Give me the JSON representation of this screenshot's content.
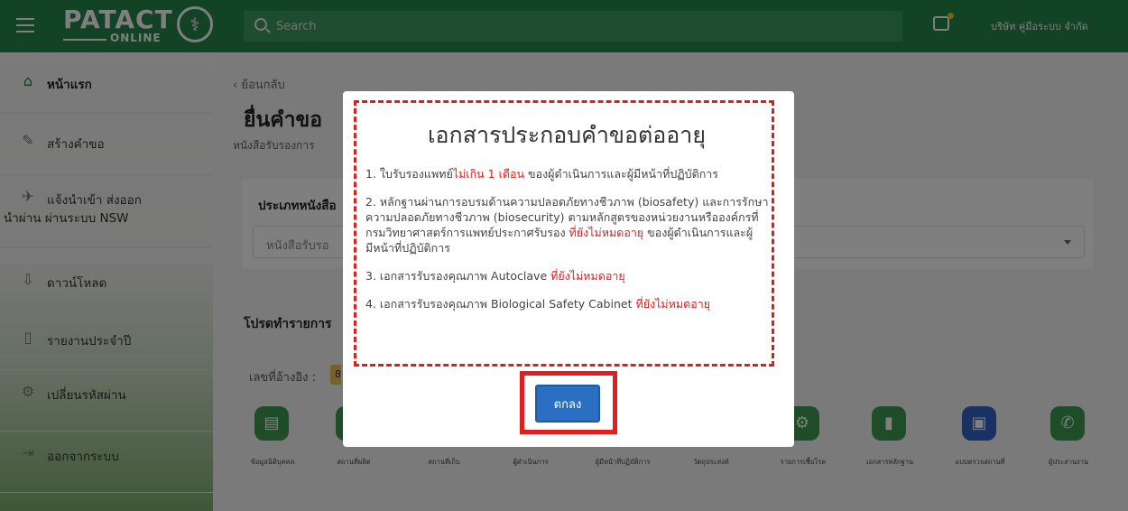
{
  "topbar": {
    "logo_main": "PATACT",
    "logo_sub": "ONLINE",
    "search_placeholder": "Search",
    "company": "บริษัท คู่มือระบบ จำกัด",
    "colors": {
      "primary": "#27864a",
      "notif_dot": "#f5c518"
    }
  },
  "sidebar": {
    "items": [
      {
        "label": "หน้าแรก",
        "icon": "home-icon"
      },
      {
        "label": "สร้างคำขอ",
        "icon": "pencil-icon"
      },
      {
        "label_line1": "แจ้งนำเข้า ส่งออก",
        "label_line2": "นำผ่าน ผ่านระบบ NSW",
        "icon": "airplane-icon"
      },
      {
        "label": "ดาวน์โหลด",
        "icon": "download-icon"
      },
      {
        "label": "รายงานประจำปี",
        "icon": "document-icon"
      },
      {
        "label": "เปลี่ยนรหัสผ่าน",
        "icon": "gears-icon"
      },
      {
        "label": "ออกจากระบบ",
        "icon": "logout-icon"
      }
    ]
  },
  "main": {
    "back": "ย้อนกลับ",
    "title": "ยื่นคำขอ",
    "subtitle": "หนังสือรับรองการ",
    "card_title": "ประเภทหนังสือ",
    "select_value": "หนังสือรับรอ",
    "section_title": "โปรดทำรายการ",
    "ref_label": "เลขที่อ้างอิง :",
    "ref_value": "8",
    "steps": [
      {
        "label": "ข้อมูลนิติบุคคล",
        "icon": "id-card-icon"
      },
      {
        "label": "สถานที่ผลิต",
        "icon": "factory-icon"
      },
      {
        "label": "สถานที่เก็บ",
        "icon": "warehouse-icon"
      },
      {
        "label": "ผู้ดำเนินการ",
        "icon": "person-icon"
      },
      {
        "label": "ผู้มีหน้าที่ปฏิบัติการ",
        "icon": "people-icon"
      },
      {
        "label": "วัตถุประสงค์",
        "icon": "target-icon"
      },
      {
        "label": "รายการเชื้อโรค",
        "icon": "gears-icon"
      },
      {
        "label": "เอกสารหลักฐาน",
        "icon": "file-icon"
      },
      {
        "label": "แบบตรวจสถานที่",
        "icon": "clipboard-icon"
      },
      {
        "label": "ผู้ประสานงาน",
        "icon": "phone-icon"
      }
    ]
  },
  "modal": {
    "title": "เอกสารประกอบคำขอต่ออายุ",
    "items": [
      {
        "pre": "1. ใบรับรองแพทย์",
        "hl": "ไม่เกิน 1 เดือน",
        "post": " ของผู้ดำเนินการและผู้มีหน้าที่ปฏิบัติการ"
      },
      {
        "pre": "2. หลักฐานผ่านการอบรมด้านความปลอดภัยทางชีวภาพ (biosafety) และการรักษาความปลอดภัยทางชีวภาพ (biosecurity) ตามหลักสูตรของหน่วยงานหรือองค์กรที่กรมวิทยาศาสตร์การแพทย์ประกาศรับรอง ",
        "hl": "ที่ยังไม่หมดอายุ",
        "post": " ของผู้ดำเนินการและผู้มีหน้าที่ปฏิบัติการ"
      },
      {
        "pre": "3. เอกสารรับรองคุณภาพ Autoclave ",
        "hl": "ที่ยังไม่หมดอายุ",
        "post": ""
      },
      {
        "pre": "4. เอกสารรับรองคุณภาพ Biological Safety Cabinet ",
        "hl": "ที่ยังไม่หมดอายุ",
        "post": ""
      }
    ],
    "ok_label": "ตกลง",
    "colors": {
      "highlight": "#e11d1d",
      "button": "#2a6fc1"
    }
  }
}
